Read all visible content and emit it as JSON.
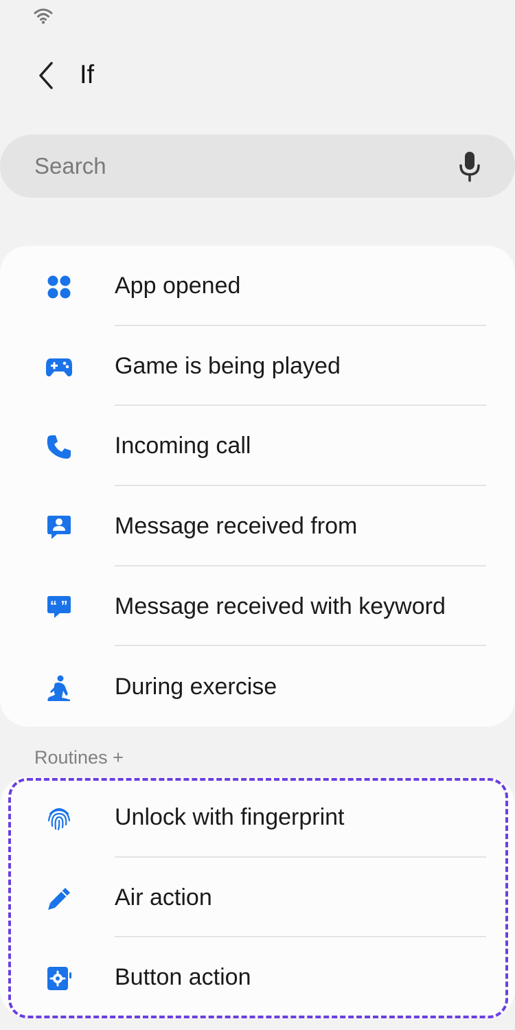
{
  "header": {
    "title": "If",
    "back_icon": "chevron-left-icon"
  },
  "search": {
    "placeholder": "Search",
    "mic_icon": "microphone-icon"
  },
  "conditions": {
    "items": [
      {
        "label": "App opened",
        "icon": "apps-grid-icon"
      },
      {
        "label": "Game is being played",
        "icon": "gamepad-icon"
      },
      {
        "label": "Incoming call",
        "icon": "phone-icon"
      },
      {
        "label": "Message received from",
        "icon": "contact-message-icon"
      },
      {
        "label": "Message received with keyword",
        "icon": "quote-message-icon"
      },
      {
        "label": "During exercise",
        "icon": "exercise-icon"
      }
    ]
  },
  "routines_plus": {
    "header": "Routines +",
    "items": [
      {
        "label": "Unlock with fingerprint",
        "icon": "fingerprint-icon"
      },
      {
        "label": "Air action",
        "icon": "pen-icon"
      },
      {
        "label": "Button action",
        "icon": "button-gear-icon"
      }
    ]
  },
  "colors": {
    "accent": "#1a73e8",
    "background": "#f2f2f2",
    "card": "#fcfcfc",
    "highlight": "#6a3fe0"
  }
}
